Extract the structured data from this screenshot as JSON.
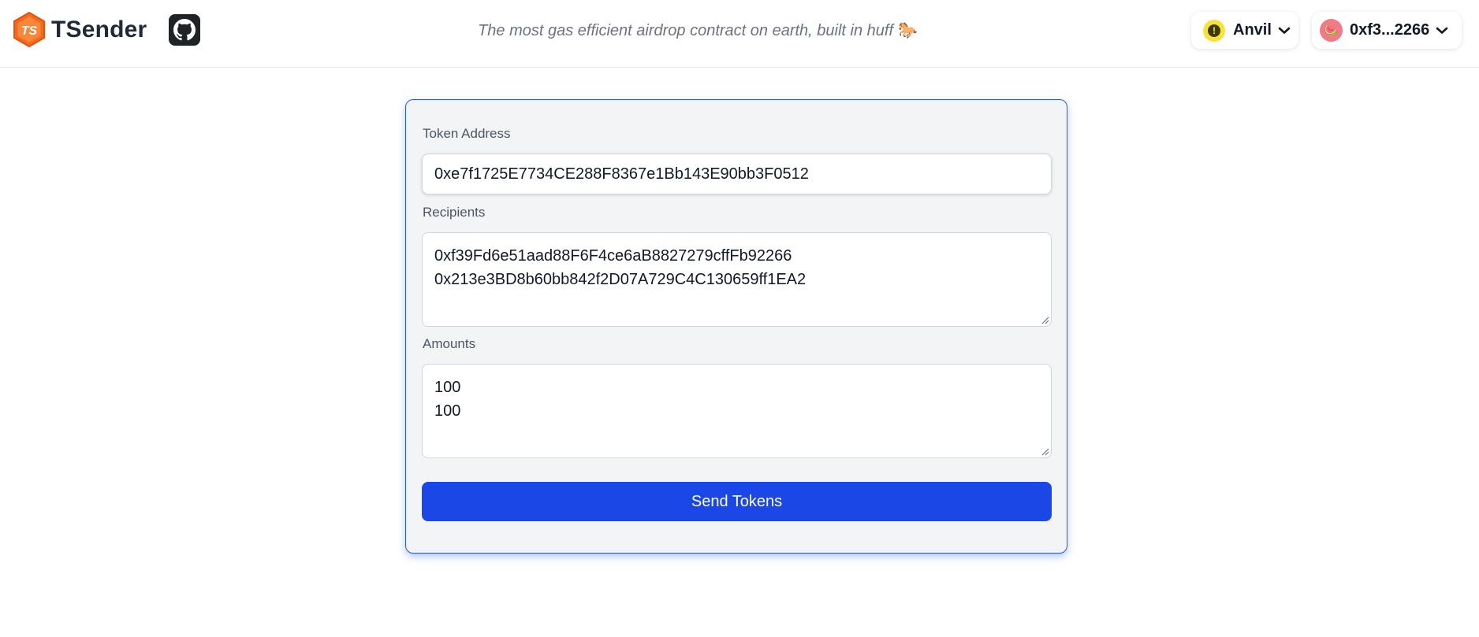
{
  "header": {
    "brand_name": "TSender",
    "logo_text": "TS",
    "tagline": "The most gas efficient airdrop contract on earth, built in huff",
    "tagline_emoji": "🐎",
    "chain": {
      "name": "Anvil",
      "status_icon": "warning-icon"
    },
    "account": {
      "address_short": "0xf3...2266",
      "avatar_emoji": "🍉"
    }
  },
  "form": {
    "token_address_label": "Token Address",
    "token_address_value": "0xe7f1725E7734CE288F8367e1Bb143E90bb3F0512",
    "recipients_label": "Recipients",
    "recipients": [
      "0xf39Fd6e51aad88F6F4ce6aB8827279cffFb92266",
      "0x213e3BD8b60bb842f2D07A729C4C130659ff1EA2"
    ],
    "amounts_label": "Amounts",
    "amounts": [
      "100",
      "100"
    ],
    "submit_label": "Send Tokens"
  },
  "colors": {
    "brand_orange": "#f26b1d",
    "primary_blue": "#1a47e6",
    "card_border": "#2a56e8",
    "card_bg": "#f3f4f6",
    "warning_yellow": "#f9e23b",
    "avatar_pink": "#f07a86"
  }
}
